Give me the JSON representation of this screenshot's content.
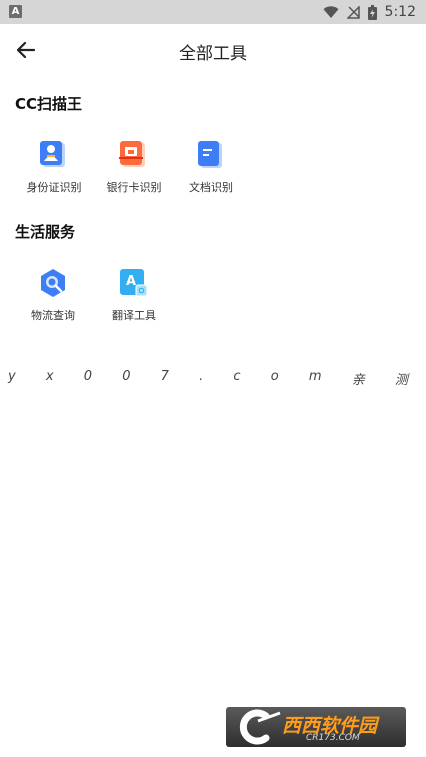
{
  "status_bar": {
    "left_icon_glyph": "A",
    "left_icon": "notification-a-icon",
    "time": "5:12",
    "icons": [
      "wifi-icon",
      "signal-off-icon",
      "battery-charging-icon"
    ]
  },
  "header": {
    "back_icon": "arrow-left-icon",
    "title": "全部工具"
  },
  "sections": [
    {
      "title": "CC扫描王",
      "tools": [
        {
          "label": "身份证识别",
          "icon": "id-card-icon",
          "color": "#3d7df5"
        },
        {
          "label": "银行卡识别",
          "icon": "bank-card-icon",
          "color": "#ff6a3d"
        },
        {
          "label": "文档识别",
          "icon": "document-icon",
          "color": "#3d7df5"
        }
      ]
    },
    {
      "title": "生活服务",
      "tools": [
        {
          "label": "物流查询",
          "icon": "logistics-search-icon",
          "color": "#3d7df5"
        },
        {
          "label": "翻译工具",
          "icon": "translate-icon",
          "color": "#33aef0"
        }
      ]
    }
  ],
  "watermark": [
    "y",
    "x",
    "0",
    "0",
    "7",
    ".",
    "c",
    "o",
    "m",
    "亲",
    "测"
  ],
  "logo": {
    "text": "西西软件园",
    "subtext": "CR173.COM"
  }
}
